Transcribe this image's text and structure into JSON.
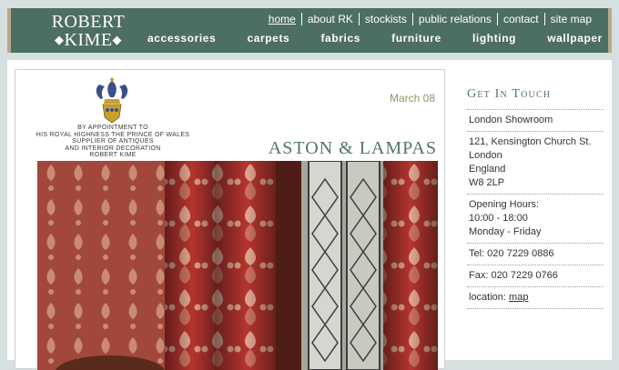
{
  "logo": {
    "line1": "ROBERT",
    "line2": "KIME",
    "diamond": "◆"
  },
  "util_nav": [
    {
      "label": "home",
      "active": true
    },
    {
      "label": "about RK"
    },
    {
      "label": "stockists"
    },
    {
      "label": "public relations"
    },
    {
      "label": "contact"
    },
    {
      "label": "site map"
    }
  ],
  "main_nav": [
    "accessories",
    "carpets",
    "fabrics",
    "furniture",
    "lighting",
    "wallpaper"
  ],
  "article": {
    "warrant": [
      "BY APPOINTMENT TO",
      "HIS ROYAL HIGHNESS THE PRINCE OF WALES",
      "SUPPLIER OF ANTIQUES",
      "AND INTERIOR DECORATION",
      "ROBERT KIME"
    ],
    "date": "March 08",
    "title": "ASTON & LAMPAS"
  },
  "sidebar": {
    "title": "Get In Touch",
    "showroom": "London Showroom",
    "address": [
      "121, Kensington Church St.",
      "London",
      "England",
      "W8 2LP"
    ],
    "hours_label": "Opening Hours:",
    "hours_time": "10:00 - 18:00",
    "hours_days": "Monday - Friday",
    "tel": "Tel: 020 7229 0886",
    "fax": "Fax: 020 7229 0766",
    "location_label": "location:",
    "location_link": "map"
  },
  "colors": {
    "header": "#4d6e63",
    "accent_green": "#52756a",
    "date": "#8a9a60",
    "fabric_red": "#b23a33"
  }
}
